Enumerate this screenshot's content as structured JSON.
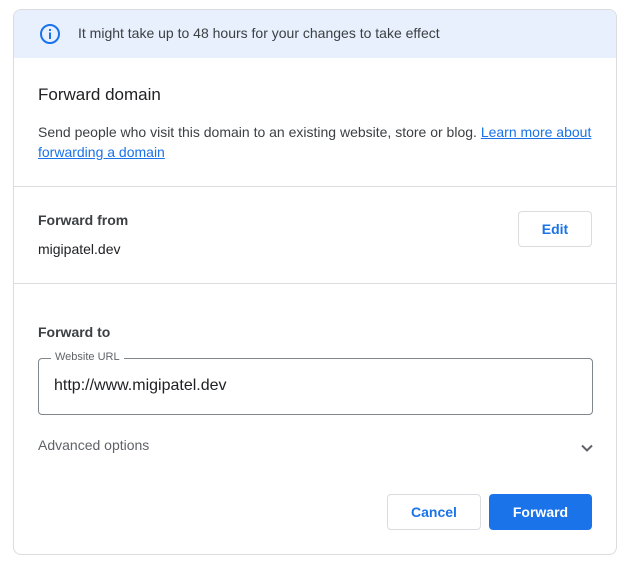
{
  "banner": {
    "icon": "info-icon",
    "text": "It might take up to 48 hours for your changes to take effect"
  },
  "header": {
    "title": "Forward domain",
    "description": "Send people who visit this domain to an existing website, store or blog.",
    "learn_more_link": "Learn more about forwarding a domain"
  },
  "forward_from": {
    "label": "Forward from",
    "value": "migipatel.dev",
    "edit_label": "Edit"
  },
  "forward_to": {
    "label": "Forward to",
    "field_label": "Website URL",
    "field_value": "http://www.migipatel.dev"
  },
  "advanced": {
    "label": "Advanced options",
    "icon": "chevron-down-icon"
  },
  "actions": {
    "cancel_label": "Cancel",
    "forward_label": "Forward"
  },
  "colors": {
    "accent": "#1a73e8",
    "banner_bg": "#e8f0fe"
  }
}
